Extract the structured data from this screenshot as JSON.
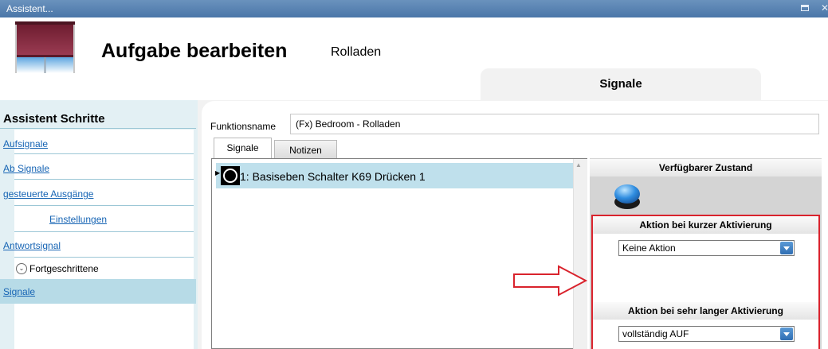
{
  "window": {
    "title": "Assistent..."
  },
  "header": {
    "title": "Aufgabe bearbeiten",
    "subtitle": "Rolladen",
    "tab": "Signale"
  },
  "sidebar": {
    "title": "Assistent Schritte",
    "items": [
      {
        "label": "Aufsignale"
      },
      {
        "label": "Ab Signale"
      },
      {
        "label": "gesteuerte Ausgänge"
      },
      {
        "label": "Einstellungen"
      },
      {
        "label": "Antwortsignal"
      }
    ],
    "advanced": {
      "label": "Fortgeschrittene",
      "items": [
        {
          "label": "Signale"
        }
      ]
    }
  },
  "form": {
    "function_name_label": "Funktionsname",
    "function_name_value": "(Fx) Bedroom - Rolladen"
  },
  "tabs": [
    {
      "label": "Signale"
    },
    {
      "label": "Notizen"
    }
  ],
  "signals": [
    {
      "label": "1: Basiseben Schalter K69 Drücken 1"
    }
  ],
  "state_panel": {
    "header": "Verfügbarer Zustand",
    "short_action_label": "Aktion bei kurzer Aktivierung",
    "short_action_value": "Keine Aktion",
    "long_action_label": "Aktion bei sehr langer Aktivierung",
    "long_action_value": "vollständig AUF"
  },
  "colors": {
    "highlight": "#d9232d",
    "accent": "#4a76a8",
    "selection": "#bfe0ec"
  }
}
